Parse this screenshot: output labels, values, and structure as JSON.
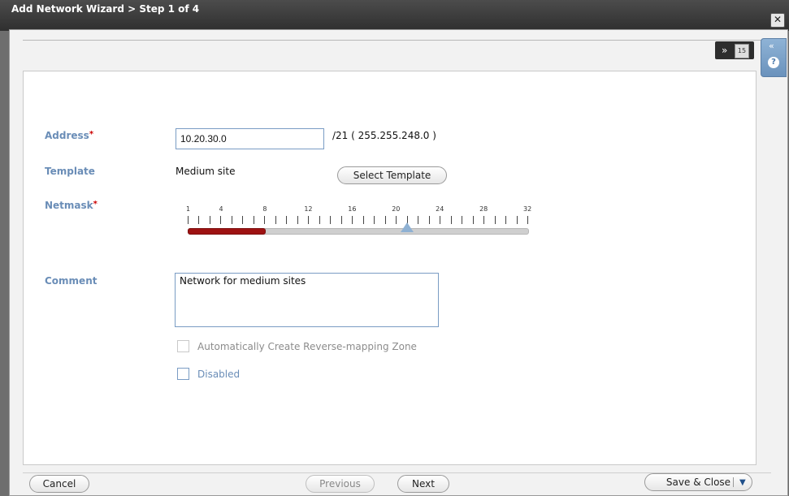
{
  "window": {
    "title": "Add Network Wizard > Step 1 of 4"
  },
  "form": {
    "address": {
      "label": "Address",
      "value": "10.20.30.0",
      "cidr_text": "/21 ( 255.255.248.0 )"
    },
    "template": {
      "label": "Template",
      "value": "Medium site",
      "select_button": "Select Template"
    },
    "netmask": {
      "label": "Netmask",
      "ticks": [
        "1",
        "4",
        "8",
        "12",
        "16",
        "20",
        "24",
        "28",
        "32"
      ],
      "value": 21,
      "min": 1,
      "max": 32,
      "filled_to": 8
    },
    "comment": {
      "label": "Comment",
      "value": "Network for medium sites"
    },
    "checkboxes": {
      "auto_reverse": "Automatically Create Reverse-mapping Zone",
      "disabled": "Disabled"
    }
  },
  "buttons": {
    "cancel": "Cancel",
    "previous": "Previous",
    "next": "Next",
    "save_close": "Save & Close"
  },
  "icons": {
    "close": "close-icon",
    "toolbar_expand": "double-chevron-down-icon",
    "calendar": "calendar-icon",
    "help": "help-icon",
    "collapse": "double-chevron-left-icon"
  }
}
